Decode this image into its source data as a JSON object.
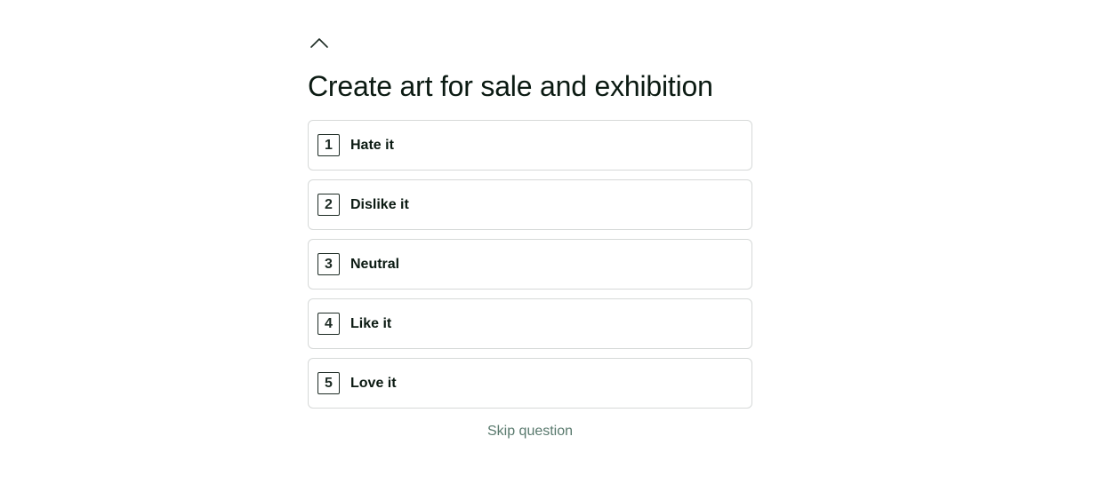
{
  "navigation": {
    "back_icon": "chevron-up-icon"
  },
  "question": {
    "title": "Create art for sale and exhibition"
  },
  "options": [
    {
      "key": "1",
      "label": "Hate it"
    },
    {
      "key": "2",
      "label": "Dislike it"
    },
    {
      "key": "3",
      "label": "Neutral"
    },
    {
      "key": "4",
      "label": "Like it"
    },
    {
      "key": "5",
      "label": "Love it"
    }
  ],
  "skip": {
    "label": "Skip question"
  },
  "colors": {
    "text": "#0b1a12",
    "border": "#d6d9d8",
    "skip": "#5a7a6e"
  }
}
